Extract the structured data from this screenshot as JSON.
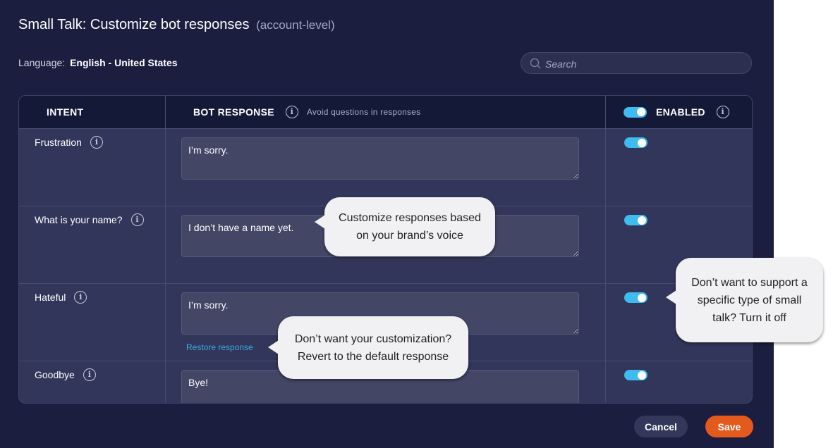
{
  "header": {
    "title": "Small Talk: Customize bot responses",
    "subtitle": "(account-level)",
    "language_label": "Language:",
    "language_value": "English - United States"
  },
  "search": {
    "placeholder": "Search",
    "value": ""
  },
  "table": {
    "columns": {
      "intent": "INTENT",
      "bot_response": "BOT RESPONSE",
      "bot_response_hint": "Avoid questions in responses",
      "enabled": "ENABLED"
    },
    "header_toggle_on": true,
    "rows": [
      {
        "intent": "Frustration",
        "response": "I’m sorry.",
        "enabled": true,
        "restore_link": null
      },
      {
        "intent": "What is your name?",
        "response": "I don’t have a name yet.",
        "enabled": true,
        "restore_link": null
      },
      {
        "intent": "Hateful",
        "response": "I’m sorry.",
        "enabled": true,
        "restore_link": "Restore response"
      },
      {
        "intent": "Goodbye",
        "response": "Bye!",
        "enabled": true,
        "restore_link": null
      }
    ]
  },
  "footer": {
    "cancel_label": "Cancel",
    "save_label": "Save"
  },
  "callouts": {
    "customize": "Customize responses based on your brand’s voice",
    "restore": "Don’t want your customization? Revert to the default response",
    "toggle": "Don’t want to support a specific type of small talk? Turn it off"
  },
  "colors": {
    "background": "#1b1e3f",
    "accent_toggle": "#3fbcef",
    "save_button": "#e45a1d",
    "link": "#3fa9e0"
  }
}
